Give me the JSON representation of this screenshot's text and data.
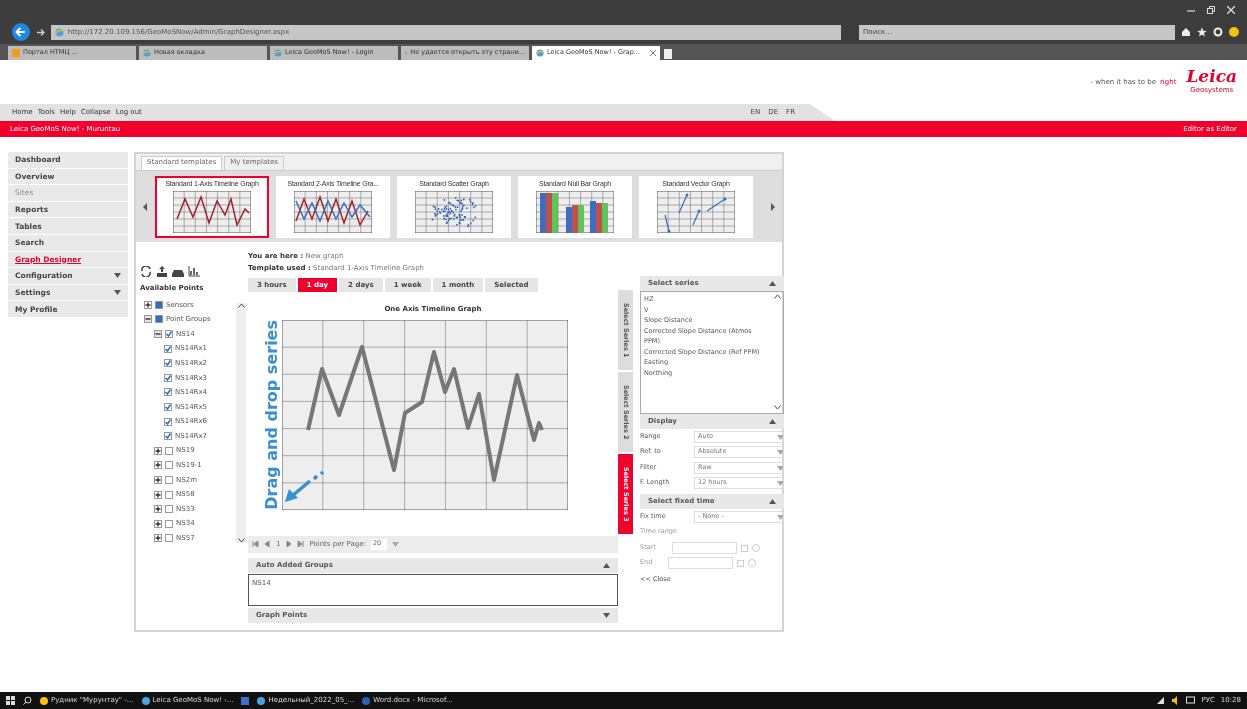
{
  "browser": {
    "address": "http://172.20.109.156/GeoMoSNow/Admin/GraphDesigner.aspx",
    "search_placeholder": "Поиск...",
    "tabs": [
      {
        "label": "Портал НТМЦ ...",
        "selected": false
      },
      {
        "label": "Новая вкладка",
        "selected": false
      },
      {
        "label": "Leica GeoMoS Now! - Login",
        "selected": false
      },
      {
        "label": "Не удается открыть эту страни...",
        "selected": false
      },
      {
        "label": "Leica GeoMoS Now! - Grap...",
        "selected": true
      }
    ]
  },
  "header": {
    "tagline": "- when it has to be",
    "tagline_accent": "right",
    "logo": "Leica",
    "logo_sub": "Geosystems"
  },
  "menu": [
    "Home",
    "Tools",
    "Help",
    "Collapse",
    "Log out"
  ],
  "languages": [
    "EN",
    "DE",
    "FR"
  ],
  "title_bar": {
    "title": "Leica GeoMoS Now! - Muruntau",
    "user": "Editor as Editor"
  },
  "sidebar": [
    {
      "label": "Dashboard",
      "selected": false,
      "disabled": false,
      "expandable": false
    },
    {
      "label": "Overview",
      "selected": false,
      "disabled": false,
      "expandable": false
    },
    {
      "label": "Sites",
      "selected": false,
      "disabled": true,
      "expandable": false
    },
    {
      "label": "Reports",
      "selected": false,
      "disabled": false,
      "expandable": false
    },
    {
      "label": "Tables",
      "selected": false,
      "disabled": false,
      "expandable": false
    },
    {
      "label": "Search",
      "selected": false,
      "disabled": false,
      "expandable": false
    },
    {
      "label": "Graph Designer",
      "selected": true,
      "disabled": false,
      "expandable": false
    },
    {
      "label": "Configuration",
      "selected": false,
      "disabled": false,
      "expandable": true
    },
    {
      "label": "Settings",
      "selected": false,
      "disabled": false,
      "expandable": true
    },
    {
      "label": "My Profile",
      "selected": false,
      "disabled": false,
      "expandable": false
    }
  ],
  "template_tabs": [
    {
      "label": "Standard templates",
      "selected": true
    },
    {
      "label": "My templates",
      "selected": false
    }
  ],
  "templates": [
    {
      "name": "Standard 1-Axis Timeline Graph",
      "kind": "timeline1",
      "selected": true
    },
    {
      "name": "Standard 2-Axis Timeline Gra...",
      "kind": "timeline2",
      "selected": false
    },
    {
      "name": "Standard Scatter Graph",
      "kind": "scatter",
      "selected": false
    },
    {
      "name": "Standard Null Bar Graph",
      "kind": "bar",
      "selected": false
    },
    {
      "name": "Standard Vector Graph",
      "kind": "vector",
      "selected": false
    }
  ],
  "breadcrumb": {
    "here_label": "You are here :",
    "here": "New graph",
    "template_label": "Template used :",
    "template": "Standard 1-Axis Timeline Graph"
  },
  "points": {
    "title": "Available Points",
    "tree": [
      {
        "label": "Sensors",
        "checked": false,
        "partial": true,
        "expanded": false
      },
      {
        "label": "Point Groups",
        "checked": false,
        "partial": true,
        "expanded": true,
        "children": [
          {
            "label": "NS14",
            "checked": true,
            "partial": false,
            "expanded": true,
            "children": [
              {
                "label": "NS14Rx1",
                "checked": true,
                "partial": false
              },
              {
                "label": "NS14Rx2",
                "checked": true,
                "partial": false
              },
              {
                "label": "NS14Rx3",
                "checked": true,
                "partial": false
              },
              {
                "label": "NS14Rx4",
                "checked": true,
                "partial": false
              },
              {
                "label": "NS14Rx5",
                "checked": true,
                "partial": false
              },
              {
                "label": "NS14Rx6",
                "checked": true,
                "partial": false
              },
              {
                "label": "NS14Rx7",
                "checked": true,
                "partial": false
              }
            ]
          },
          {
            "label": "NS19",
            "checked": false,
            "partial": false,
            "expanded": false
          },
          {
            "label": "NS19-1",
            "checked": false,
            "partial": false,
            "expanded": false
          },
          {
            "label": "NS2m",
            "checked": false,
            "partial": false,
            "expanded": false
          },
          {
            "label": "NS58",
            "checked": false,
            "partial": false,
            "expanded": false
          },
          {
            "label": "NS33",
            "checked": false,
            "partial": false,
            "expanded": false
          },
          {
            "label": "NS34",
            "checked": false,
            "partial": false,
            "expanded": false
          },
          {
            "label": "NS57",
            "checked": false,
            "partial": false,
            "expanded": false
          }
        ]
      }
    ]
  },
  "ranges": [
    {
      "label": "3 hours",
      "selected": false
    },
    {
      "label": "1 day",
      "selected": true
    },
    {
      "label": "2 days",
      "selected": false
    },
    {
      "label": "1 week",
      "selected": false
    },
    {
      "label": "1 month",
      "selected": false
    },
    {
      "label": "Selected",
      "selected": false
    }
  ],
  "graph": {
    "title": "One Axis Timeline Graph",
    "hint": "Drag and drop series"
  },
  "pager": {
    "page": "1",
    "per_page_label": "Points per Page:",
    "per_page": "20"
  },
  "auto_groups": {
    "title": "Auto Added Groups",
    "value": "NS14",
    "expanded": true
  },
  "graph_points": {
    "title": "Graph Points",
    "expanded": false
  },
  "series_tabs": [
    {
      "label": "Select Series 1",
      "selected": false
    },
    {
      "label": "Select Series 2",
      "selected": false
    },
    {
      "label": "Select Series 3",
      "selected": true
    }
  ],
  "series": {
    "title": "Select series",
    "items": [
      "HZ",
      "V",
      "Slope Distance",
      "Corrected Slope Distance (Atmos PPM)",
      "Corrected Slope Distance (Ref PPM)",
      "Easting",
      "Northing"
    ]
  },
  "display": {
    "title": "Display",
    "fields": [
      {
        "label": "Range",
        "value": "Auto"
      },
      {
        "label": "Ref. to",
        "value": "Absolute"
      },
      {
        "label": "Filter",
        "value": "Raw"
      },
      {
        "label": "F. Length",
        "value": "12 hours"
      }
    ]
  },
  "fixed_time": {
    "title": "Select fixed time",
    "fix_label": "Fix time",
    "fix_value": "- None -",
    "range_label": "Time range",
    "range_disabled": true,
    "start_label": "Start",
    "end_label": "End",
    "close": "<< Close"
  },
  "taskbar": {
    "items": [
      "Рудник \"Мурунтау\" -...",
      "Leica GeoMoS Now! -...",
      "Недельный_2022_05_...",
      "Word.docx - Microsof..."
    ],
    "language": "РУС",
    "clock": "10:28"
  }
}
